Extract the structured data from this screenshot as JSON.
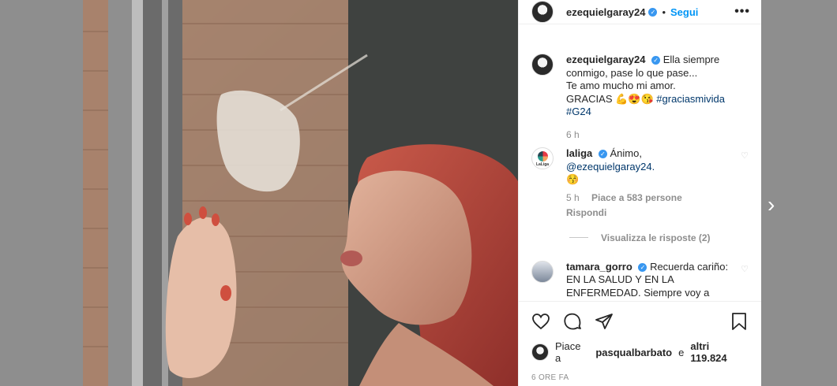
{
  "post": {
    "username": "ezequielgaray24",
    "follow_label": "Segui",
    "more_icon": "•••"
  },
  "caption": {
    "username": "ezequielgaray24",
    "line1": "Ella siempre conmigo, pase lo que pase...",
    "line2": "Te amo mucho mi amor.",
    "line3_text": "GRACIAS 💪😍😘 ",
    "hashtag1": "#graciasmivida",
    "hashtag2": "#G24",
    "time": "6 h"
  },
  "comments": [
    {
      "username": "laliga",
      "text_prefix": "Ánimo, ",
      "mention": "@ezequielgaray24.",
      "emoji": "😚",
      "time": "5 h",
      "likes": "Piace a 583 persone",
      "reply": "Rispondi",
      "view_replies": "Visualizza le risposte (2)"
    },
    {
      "username": "tamara_gorro",
      "text": "Recuerda cariño: EN LA SALUD Y EN LA ENFERMEDAD. Siempre voy a estar"
    }
  ],
  "likes": {
    "prefix": "Piace a",
    "user": "pasqualbarbato",
    "and": "e",
    "others": "altri 119.824"
  },
  "time_ago": "6 ORE FA",
  "colors": {
    "link": "#0095f6",
    "tag": "#00376b",
    "verified": "#3897f0"
  },
  "icons": [
    "heart-icon",
    "comment-icon",
    "share-icon",
    "bookmark-icon",
    "next-arrow-icon"
  ]
}
